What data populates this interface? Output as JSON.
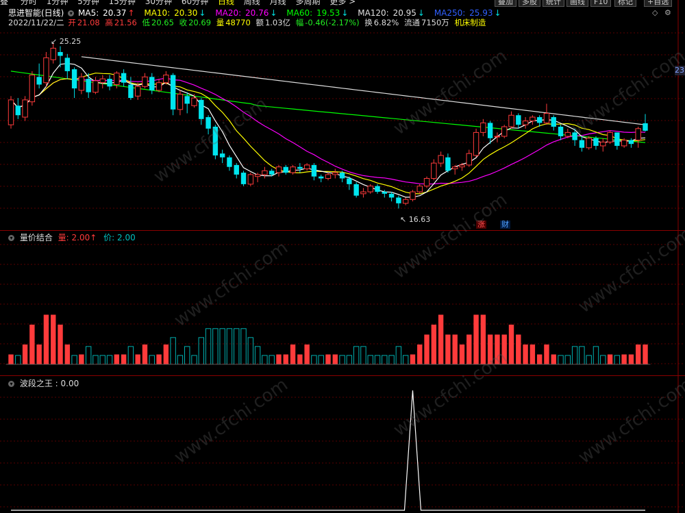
{
  "periods": [
    "分时",
    "1分钟",
    "5分钟",
    "15分钟",
    "30分钟",
    "60分钟",
    "日线",
    "周线",
    "月线",
    "多周期",
    "更多 >"
  ],
  "toolbar": [
    "叠加",
    "多股",
    "统计",
    "画线",
    "F10",
    "标记",
    "+自选"
  ],
  "toolbar_left": "叠",
  "main": {
    "title": "思进智能(日线)",
    "ma": [
      {
        "label": "MA5:",
        "value": "20.37",
        "arrow": "↑",
        "color": "#ffffff"
      },
      {
        "label": "MA10:",
        "value": "20.30",
        "arrow": "↓",
        "color": "#ffff00"
      },
      {
        "label": "MA20:",
        "value": "20.76",
        "arrow": "↓",
        "color": "#ff00ff"
      },
      {
        "label": "MA60:",
        "value": "19.53",
        "arrow": "↓",
        "color": "#00ff00"
      },
      {
        "label": "MA120:",
        "value": "20.95",
        "arrow": "↓",
        "color": "#e0e0e0"
      },
      {
        "label": "MA250:",
        "value": "25.93",
        "arrow": "↓",
        "color": "#3060ff"
      }
    ],
    "info": {
      "date": "2022/11/22/二",
      "open_label": "开",
      "open": "21.08",
      "high_label": "高",
      "high": "21.56",
      "low_label": "低",
      "low": "20.65",
      "close_label": "收",
      "close": "20.69",
      "vol_label": "量",
      "vol": "48770",
      "amt_label": "额",
      "amt": "1.03亿",
      "amp_label": "幅",
      "amp": "-0.46(-2.17%)",
      "turn_label": "换",
      "turn": "6.82%",
      "float_label": "流通",
      "float": "7150万",
      "sector": "机床制造"
    },
    "high_mark": "25.25",
    "low_mark": "16.63",
    "right_price": "23",
    "badges": [
      "涨",
      "财"
    ]
  },
  "panel2": {
    "title": "量价结合",
    "vol_label": "量: 2.00",
    "vol_arrow": "↑",
    "price_label": "价: 2.00"
  },
  "panel3": {
    "title": "波段之王 : 0.00"
  },
  "watermark": "www.cfchi.com",
  "colors": {
    "up": "#ff3b3b",
    "down": "#00e5ee",
    "green": "#22ee22",
    "grid": "#5a0000",
    "ma5": "#ffffff",
    "ma10": "#ffff00",
    "ma20": "#ff00ff",
    "ma60": "#00ff00",
    "ma120": "#e0e0e0"
  },
  "chart_data": {
    "type": "candlestick",
    "price_range": [
      16.63,
      25.25
    ],
    "candles": [
      [
        21.0,
        22.3,
        20.8,
        22.5
      ],
      [
        22.0,
        21.5,
        21.3,
        22.4
      ],
      [
        21.4,
        22.3,
        21.2,
        22.5
      ],
      [
        22.2,
        23.6,
        22.0,
        23.8
      ],
      [
        23.5,
        23.1,
        22.9,
        24.2
      ],
      [
        23.2,
        24.5,
        23.0,
        24.8
      ],
      [
        24.4,
        25.0,
        24.2,
        25.25
      ],
      [
        24.8,
        24.6,
        24.0,
        25.1
      ],
      [
        24.5,
        23.8,
        23.4,
        24.7
      ],
      [
        23.9,
        22.9,
        22.4,
        24.0
      ],
      [
        22.8,
        23.5,
        22.6,
        23.7
      ],
      [
        23.4,
        22.7,
        22.4,
        23.7
      ],
      [
        22.7,
        23.3,
        22.6,
        23.5
      ],
      [
        23.2,
        23.4,
        22.9,
        23.6
      ],
      [
        23.4,
        23.0,
        22.8,
        23.6
      ],
      [
        23.1,
        23.7,
        22.9,
        23.8
      ],
      [
        23.7,
        23.2,
        23.0,
        23.9
      ],
      [
        23.1,
        22.4,
        22.3,
        23.5
      ],
      [
        22.5,
        23.0,
        22.3,
        23.2
      ],
      [
        23.0,
        23.5,
        22.9,
        23.7
      ],
      [
        23.5,
        22.8,
        22.6,
        23.7
      ],
      [
        22.8,
        23.2,
        22.7,
        23.4
      ],
      [
        23.2,
        23.6,
        23.1,
        23.8
      ],
      [
        23.6,
        21.8,
        21.5,
        23.7
      ],
      [
        21.8,
        22.6,
        21.5,
        22.8
      ],
      [
        22.5,
        22.1,
        21.6,
        22.7
      ],
      [
        22.0,
        22.4,
        21.9,
        22.6
      ],
      [
        22.3,
        21.3,
        21.0,
        22.4
      ],
      [
        21.4,
        20.8,
        20.5,
        21.5
      ],
      [
        20.9,
        19.4,
        19.2,
        21.0
      ],
      [
        19.5,
        19.3,
        19.0,
        19.7
      ],
      [
        19.3,
        18.8,
        18.6,
        19.4
      ],
      [
        18.9,
        18.4,
        18.2,
        19.0
      ],
      [
        18.5,
        17.9,
        17.8,
        18.6
      ],
      [
        17.9,
        18.4,
        17.8,
        18.5
      ],
      [
        18.3,
        18.4,
        18.0,
        18.5
      ],
      [
        18.4,
        18.6,
        18.2,
        18.8
      ],
      [
        18.6,
        18.4,
        18.3,
        18.7
      ],
      [
        18.5,
        18.8,
        18.3,
        18.9
      ],
      [
        18.8,
        18.5,
        18.4,
        18.9
      ],
      [
        18.5,
        18.8,
        18.4,
        18.9
      ],
      [
        18.8,
        18.7,
        18.5,
        19.0
      ],
      [
        18.7,
        18.9,
        18.6,
        19.0
      ],
      [
        18.9,
        18.3,
        18.1,
        19.0
      ],
      [
        18.3,
        18.2,
        18.0,
        18.4
      ],
      [
        18.2,
        18.4,
        18.1,
        18.5
      ],
      [
        18.4,
        18.5,
        18.2,
        18.7
      ],
      [
        18.5,
        18.2,
        18.0,
        18.6
      ],
      [
        18.2,
        17.9,
        17.6,
        18.3
      ],
      [
        17.9,
        17.3,
        17.2,
        18.0
      ],
      [
        17.4,
        17.5,
        17.2,
        17.7
      ],
      [
        17.5,
        17.8,
        17.4,
        17.9
      ],
      [
        17.8,
        17.5,
        17.4,
        17.9
      ],
      [
        17.5,
        17.4,
        17.2,
        17.6
      ],
      [
        17.4,
        17.2,
        17.0,
        17.5
      ],
      [
        17.2,
        16.9,
        16.63,
        17.3
      ],
      [
        16.9,
        17.1,
        16.8,
        17.2
      ],
      [
        17.1,
        17.5,
        17.0,
        17.6
      ],
      [
        17.5,
        17.8,
        17.4,
        17.9
      ],
      [
        17.8,
        18.2,
        17.7,
        18.3
      ],
      [
        18.2,
        19.0,
        18.1,
        19.2
      ],
      [
        19.0,
        19.4,
        18.8,
        19.6
      ],
      [
        19.3,
        18.6,
        18.5,
        19.5
      ],
      [
        18.7,
        18.8,
        18.4,
        18.9
      ],
      [
        18.8,
        18.9,
        18.6,
        19.0
      ],
      [
        18.9,
        19.5,
        18.8,
        19.7
      ],
      [
        19.4,
        20.6,
        19.3,
        20.8
      ],
      [
        20.6,
        21.1,
        20.4,
        21.3
      ],
      [
        21.1,
        20.3,
        20.0,
        21.2
      ],
      [
        20.4,
        20.4,
        20.1,
        20.6
      ],
      [
        20.4,
        20.9,
        20.3,
        21.0
      ],
      [
        20.9,
        21.5,
        20.8,
        21.7
      ],
      [
        21.5,
        21.0,
        20.8,
        21.6
      ],
      [
        21.0,
        21.2,
        20.8,
        21.4
      ],
      [
        21.2,
        21.4,
        21.0,
        21.5
      ],
      [
        21.4,
        21.1,
        20.9,
        21.5
      ],
      [
        21.1,
        21.6,
        21.0,
        22.1
      ],
      [
        21.4,
        20.9,
        20.7,
        21.5
      ],
      [
        20.9,
        20.4,
        20.2,
        21.0
      ],
      [
        20.4,
        20.6,
        20.3,
        20.8
      ],
      [
        20.6,
        20.2,
        19.9,
        20.8
      ],
      [
        20.2,
        19.8,
        19.6,
        20.4
      ],
      [
        19.8,
        20.3,
        19.7,
        20.4
      ],
      [
        20.3,
        19.9,
        19.7,
        20.4
      ],
      [
        19.9,
        20.1,
        19.6,
        20.3
      ],
      [
        20.1,
        20.6,
        20.0,
        20.7
      ],
      [
        20.6,
        19.9,
        19.7,
        20.6
      ],
      [
        19.9,
        20.2,
        19.8,
        20.3
      ],
      [
        20.2,
        20.0,
        19.8,
        20.3
      ],
      [
        20.2,
        20.8,
        19.8,
        20.9
      ],
      [
        21.08,
        20.69,
        20.65,
        21.56
      ]
    ]
  }
}
